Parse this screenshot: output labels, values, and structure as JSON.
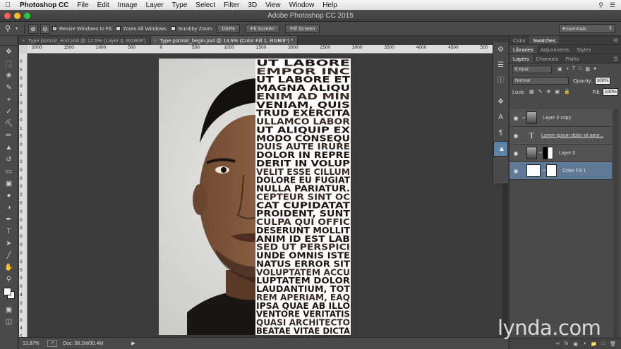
{
  "menubar": {
    "app": "Photoshop CC",
    "items": [
      "File",
      "Edit",
      "Image",
      "Layer",
      "Type",
      "Select",
      "Filter",
      "3D",
      "View",
      "Window",
      "Help"
    ]
  },
  "window": {
    "title": "Adobe Photoshop CC 2015"
  },
  "options": {
    "resize_windows": "Resize Windows to Fit",
    "zoom_all": "Zoom All Windows",
    "scrubby": "Scrubby Zoom",
    "zoom_100": "100%",
    "fit_screen": "Fit Screen",
    "fill_screen": "Fill Screen",
    "workspace": "Essentials"
  },
  "doc_tabs": [
    {
      "label": "Type portrait_end.psd @ 12.5% (Layer 0, RGB/8*)"
    },
    {
      "label": "Type portrait_begin.psd @ 13.9% (Color Fill 1, RGB/8*) *"
    }
  ],
  "ruler": {
    "h": [
      "2000",
      "1500",
      "1000",
      "500",
      "0",
      "500",
      "1000",
      "1500",
      "2000",
      "2500",
      "3000",
      "3500",
      "4000",
      "4500",
      "500"
    ],
    "v": [
      "0",
      "5",
      "0",
      "0",
      "1",
      "0",
      "0",
      "0",
      "1",
      "5",
      "0",
      "0",
      "2",
      "0",
      "0",
      "0",
      "2",
      "5",
      "0",
      "0",
      "3",
      "0",
      "0",
      "0",
      "3",
      "5",
      "0",
      "0",
      "4",
      "0",
      "0",
      "0",
      "4",
      "5"
    ]
  },
  "poster_lines": [
    "UT LABORE",
    "EMPOR INC",
    "UT LABORE ET",
    "MAGNA ALIQU",
    "ENIM AD MIN",
    "VENIAM, QUIS",
    "TRUD EXERCITA",
    "ULLAMCO LABOR",
    "UT ALIQUIP EX",
    "MODO CONSEQU",
    "DUIS AUTE IRURE",
    "DOLOR IN REPRE",
    "DERIT IN VOLUP",
    "VELIT ESSE CILLUM",
    "DOLORE EU FUGIAT",
    "NULLA PARIATUR.",
    "CEPTEUR SINT OC",
    "CAT CUPIDATAT",
    "PROIDENT, SUNT",
    "CULPA QUI OFFIC",
    "DESERUNT MOLLIT",
    "ANIM ID EST LAB",
    "SED UT PERSPICI",
    "UNDE OMNIS ISTE",
    "NATUS ERROR SIT",
    "VOLUPTATEM ACCU",
    "LUPTATEM DOLOR",
    "LAUDANTIUM, TOT",
    "REM APERIAM, EAQ",
    "IPSA QUAE AB ILLO",
    "VENTORE VERITATIS",
    "QUASI ARCHITECTO",
    "BEATAE VITAE DICTA"
  ],
  "status": {
    "zoom": "13.87%",
    "doc": "Doc: 38.2M/90.4M"
  },
  "panel": {
    "tabs_top": [
      "Color",
      "Swatches"
    ],
    "tabs_mid": [
      "Libraries",
      "Adjustments",
      "Styles"
    ],
    "tabs_layers": [
      "Layers",
      "Channels",
      "Paths"
    ],
    "kind": "Kind",
    "blend": "Normal",
    "opacity_label": "Opacity:",
    "opacity": "100%",
    "lock_label": "Lock:",
    "fill_label": "Fill:",
    "fill": "100%",
    "layers": [
      {
        "name": "Layer 0 copy"
      },
      {
        "name": "Lorem ipsum dolor sit ame..."
      },
      {
        "name": "Layer 0"
      },
      {
        "name": "Color Fill 1"
      }
    ]
  },
  "watermark": "lynda.com",
  "colors": {
    "accent": "#5f7a97",
    "ui_dark": "#3a3a3a"
  }
}
